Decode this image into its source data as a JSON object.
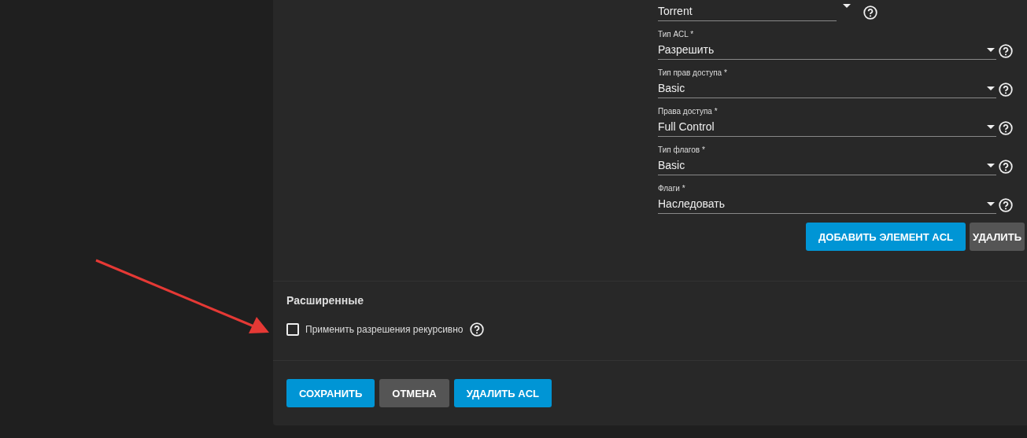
{
  "acl_fields": [
    {
      "kind": "short",
      "value": "Torrent"
    },
    {
      "kind": "full",
      "label": "Тип ACL *",
      "value": "Разрешить"
    },
    {
      "kind": "full",
      "label": "Тип прав доступа *",
      "value": "Basic"
    },
    {
      "kind": "full",
      "label": "Права доступа *",
      "value": "Full Control"
    },
    {
      "kind": "full",
      "label": "Тип флагов *",
      "value": "Basic"
    },
    {
      "kind": "full",
      "label": "Флаги *",
      "value": "Наследовать"
    }
  ],
  "acl_buttons": [
    {
      "kind": "primary",
      "label": "ДОБАВИТЬ ЭЛЕМЕНТ ACL"
    },
    {
      "kind": "secondary",
      "label": "УДАЛИТЬ"
    }
  ],
  "advanced": {
    "title": "Расширенные",
    "checkbox": {
      "label": "Применить разрешения рекурсивно",
      "checked": false
    }
  },
  "footer_buttons": [
    {
      "kind": "primary",
      "label": "СОХРАНИТЬ"
    },
    {
      "kind": "secondary",
      "label": "ОТМЕНА"
    },
    {
      "kind": "primary",
      "label": "УДАЛИТЬ ACL"
    }
  ]
}
